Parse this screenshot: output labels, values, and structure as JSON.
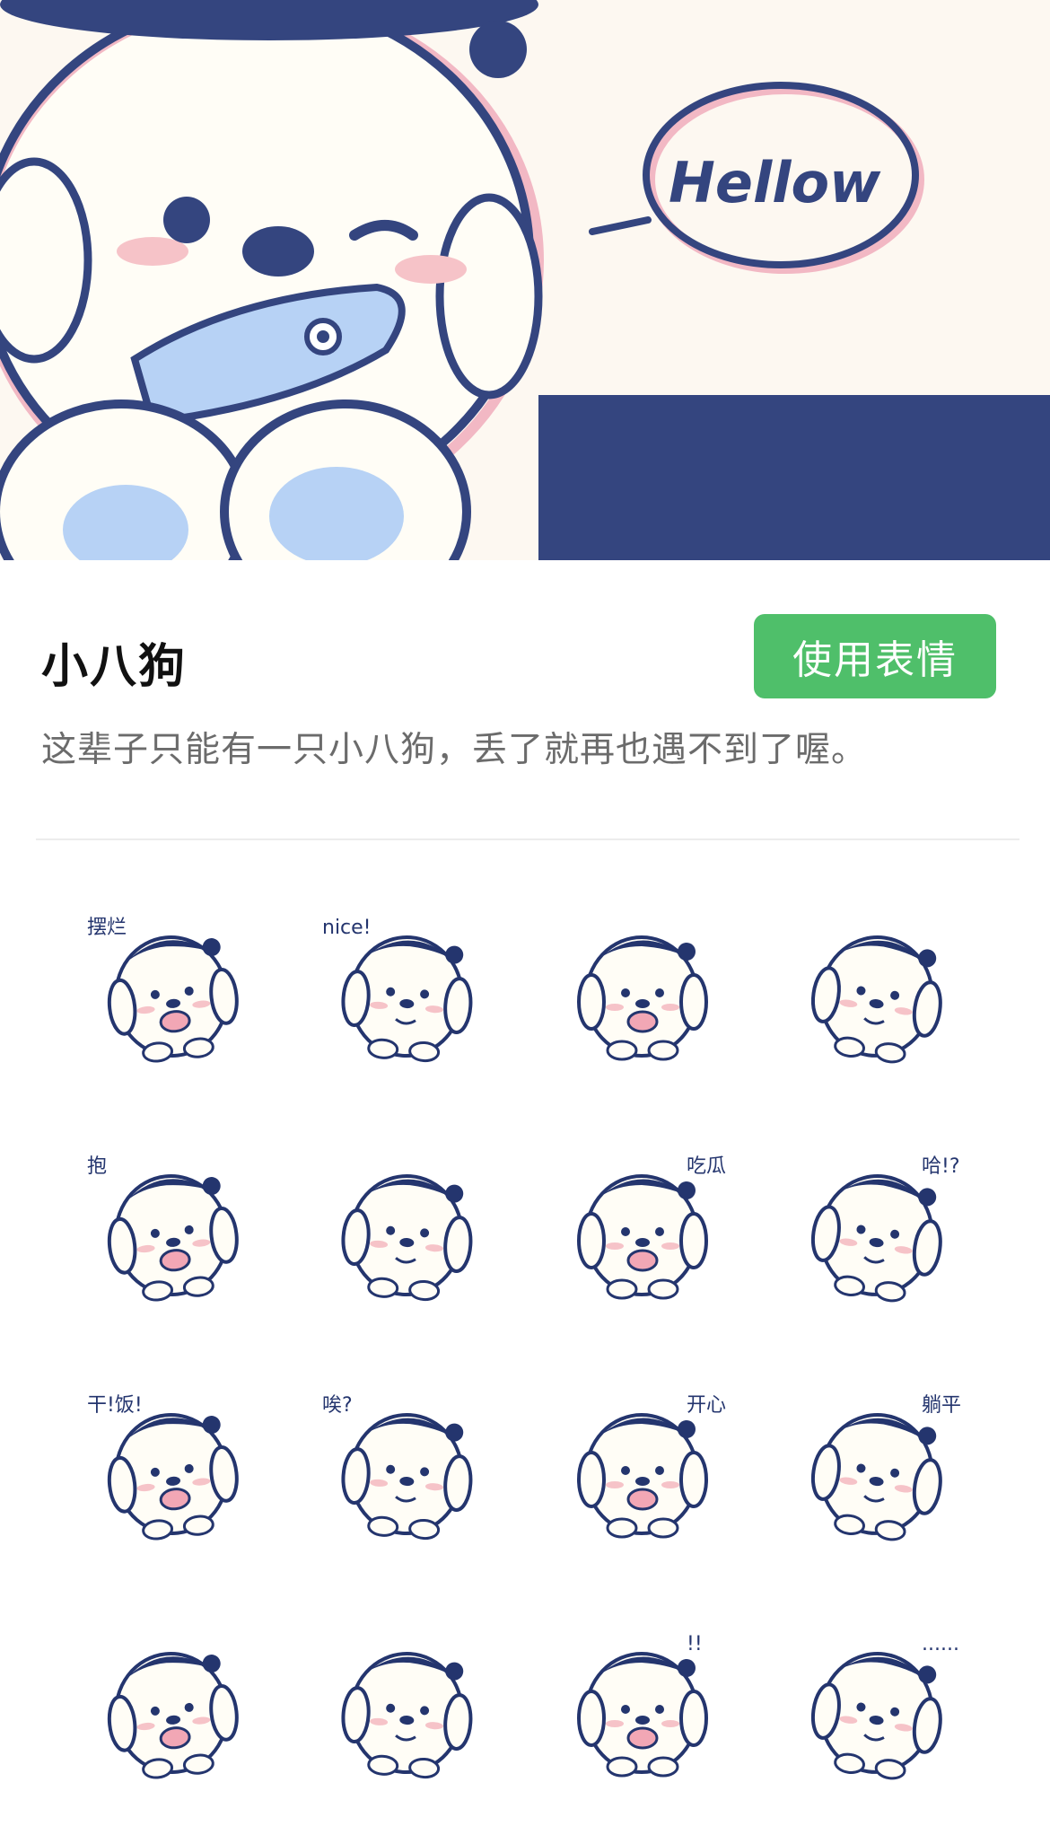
{
  "banner": {
    "speech_text": "Hellow",
    "colors": {
      "navy": "#34457f",
      "cream": "#fdf8f1",
      "pink": "#f2b8c4",
      "light_blue": "#b7d2f5"
    }
  },
  "pack": {
    "title": "小八狗",
    "use_button_label": "使用表情",
    "description": "这辈子只能有一只小八狗，丢了就再也遇不到了喔。",
    "accent_color": "#4fbf6a"
  },
  "stickers": [
    {
      "icon": "puppy-drink-sticker",
      "caption": "摆烂"
    },
    {
      "icon": "puppy-nice-sticker",
      "caption": "nice!"
    },
    {
      "icon": "puppy-heart-sticker",
      "caption": ""
    },
    {
      "icon": "puppy-broken-heart-sticker",
      "caption": ""
    },
    {
      "icon": "puppy-hug-sticker",
      "caption": "抱"
    },
    {
      "icon": "puppy-peek-sticker",
      "caption": ""
    },
    {
      "icon": "puppy-watermelon-sticker",
      "caption": "吃瓜"
    },
    {
      "icon": "puppy-phone-sticker",
      "caption": "哈!?"
    },
    {
      "icon": "puppy-eat-sticker",
      "caption": "干!饭!"
    },
    {
      "icon": "puppy-huh-sticker",
      "caption": "唉?"
    },
    {
      "icon": "puppy-happy-sticker",
      "caption": "开心"
    },
    {
      "icon": "puppy-lie-flat-sticker",
      "caption": "躺平"
    },
    {
      "icon": "puppy-sad-sticker",
      "caption": ""
    },
    {
      "icon": "puppy-sleep-sticker",
      "caption": ""
    },
    {
      "icon": "puppy-shock-sticker",
      "caption": "!!"
    },
    {
      "icon": "puppy-speechless-sticker",
      "caption": "......"
    }
  ]
}
